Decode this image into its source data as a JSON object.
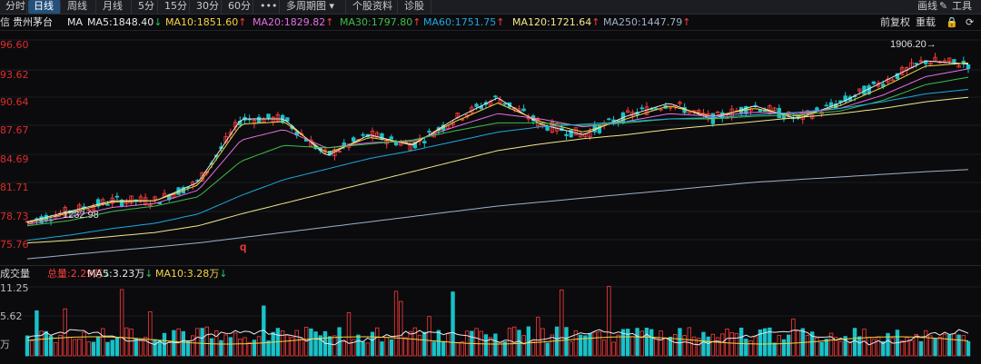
{
  "toolbar": {
    "tabs": [
      {
        "label": "分时"
      },
      {
        "label": "日线",
        "active": true
      },
      {
        "label": "周线"
      },
      {
        "label": "月线"
      },
      {
        "label": "5分"
      },
      {
        "label": "15分"
      },
      {
        "label": "30分"
      },
      {
        "label": "60分"
      },
      {
        "label": "•••"
      },
      {
        "label": "多周期图 ▾"
      },
      {
        "label": "个股资料"
      },
      {
        "label": "诊股"
      }
    ],
    "right": {
      "draw": "画线",
      "tools": "工具"
    }
  },
  "ma_bar": {
    "stock_name": "贵州茅台",
    "ma_label": "MA",
    "right_fq": "前复权",
    "right_pile": "重载",
    "items": [
      {
        "text": "MA5:1848.40",
        "arrow": "↓",
        "color": "#e8e8e8",
        "arrow_color": "#22c55e"
      },
      {
        "text": "MA10:1851.60",
        "arrow": "↑",
        "color": "#f5d442",
        "arrow_color": "#ff3b3b"
      },
      {
        "text": "MA20:1829.82",
        "arrow": "↑",
        "color": "#e66ee6",
        "arrow_color": "#ff3b3b"
      },
      {
        "text": "MA30:1797.80",
        "arrow": "↑",
        "color": "#3cbf4a",
        "arrow_color": "#ff3b3b"
      },
      {
        "text": "MA60:1751.75",
        "arrow": "↑",
        "color": "#1ea7e0",
        "arrow_color": "#ff3b3b"
      },
      {
        "text": "MA120:1721.64",
        "arrow": "↑",
        "color": "#f2e88a",
        "arrow_color": "#ff3b3b"
      },
      {
        "text": "MA250:1447.79",
        "arrow": "↑",
        "color": "#9fb0c8",
        "arrow_color": "#ff3b3b"
      }
    ]
  },
  "price_axis": [
    "96.60",
    "93.62",
    "90.64",
    "87.67",
    "84.69",
    "81.71",
    "78.73",
    "75.76"
  ],
  "annotations": {
    "high": "1906.20→",
    "low": "←1232.98",
    "marker": "q"
  },
  "volume_bar": {
    "label": "成交量",
    "total": "总量:2.29万",
    "total_arrow": "↓",
    "ma5": "MA5:3.23万",
    "ma5_arrow": "↓",
    "ma10": "MA10:3.28万",
    "ma10_arrow": "↓",
    "axis": [
      "11.25",
      "5.62",
      "万"
    ]
  },
  "colors": {
    "up": "#ff3b3b",
    "down": "#18c2c9",
    "ma5": "#e8e8e8",
    "ma10": "#f5d442",
    "ma20": "#e66ee6",
    "ma30": "#3cbf4a",
    "ma60": "#1ea7e0",
    "ma120": "#f2e88a",
    "ma250": "#9fb0c8"
  },
  "chart_data": {
    "type": "line",
    "title": "贵州茅台 日线",
    "ylim": [
      1100,
      1960
    ],
    "series": [
      {
        "name": "MA5",
        "values": [
          1250,
          1290,
          1330,
          1330,
          1400,
          1640,
          1640,
          1500,
          1580,
          1540,
          1640,
          1720,
          1620,
          1580,
          1650,
          1700,
          1640,
          1690,
          1640,
          1700,
          1780,
          1860,
          1848
        ]
      },
      {
        "name": "MA10",
        "values": [
          1245,
          1285,
          1325,
          1330,
          1390,
          1620,
          1630,
          1510,
          1570,
          1545,
          1630,
          1700,
          1630,
          1590,
          1640,
          1690,
          1650,
          1680,
          1650,
          1690,
          1760,
          1840,
          1852
        ]
      },
      {
        "name": "MA20",
        "values": [
          1240,
          1270,
          1305,
          1320,
          1370,
          1560,
          1600,
          1530,
          1550,
          1555,
          1610,
          1660,
          1640,
          1610,
          1630,
          1660,
          1650,
          1665,
          1660,
          1680,
          1730,
          1800,
          1830
        ]
      },
      {
        "name": "MA30",
        "values": [
          1235,
          1255,
          1290,
          1310,
          1345,
          1480,
          1540,
          1530,
          1545,
          1560,
          1595,
          1625,
          1625,
          1615,
          1625,
          1640,
          1640,
          1650,
          1655,
          1670,
          1710,
          1770,
          1798
        ]
      },
      {
        "name": "MA60",
        "values": [
          1180,
          1200,
          1225,
          1245,
          1280,
          1350,
          1410,
          1450,
          1490,
          1520,
          1555,
          1590,
          1610,
          1620,
          1630,
          1640,
          1645,
          1655,
          1665,
          1680,
          1705,
          1735,
          1752
        ]
      },
      {
        "name": "MA120",
        "values": [
          1170,
          1180,
          1195,
          1210,
          1235,
          1280,
          1320,
          1360,
          1400,
          1440,
          1480,
          1520,
          1545,
          1565,
          1580,
          1600,
          1615,
          1630,
          1645,
          1660,
          1680,
          1705,
          1722
        ]
      },
      {
        "name": "MA250",
        "values": [
          1110,
          1125,
          1140,
          1155,
          1170,
          1190,
          1210,
          1230,
          1250,
          1270,
          1290,
          1310,
          1325,
          1340,
          1355,
          1370,
          1385,
          1400,
          1410,
          1420,
          1430,
          1440,
          1448
        ]
      }
    ]
  }
}
